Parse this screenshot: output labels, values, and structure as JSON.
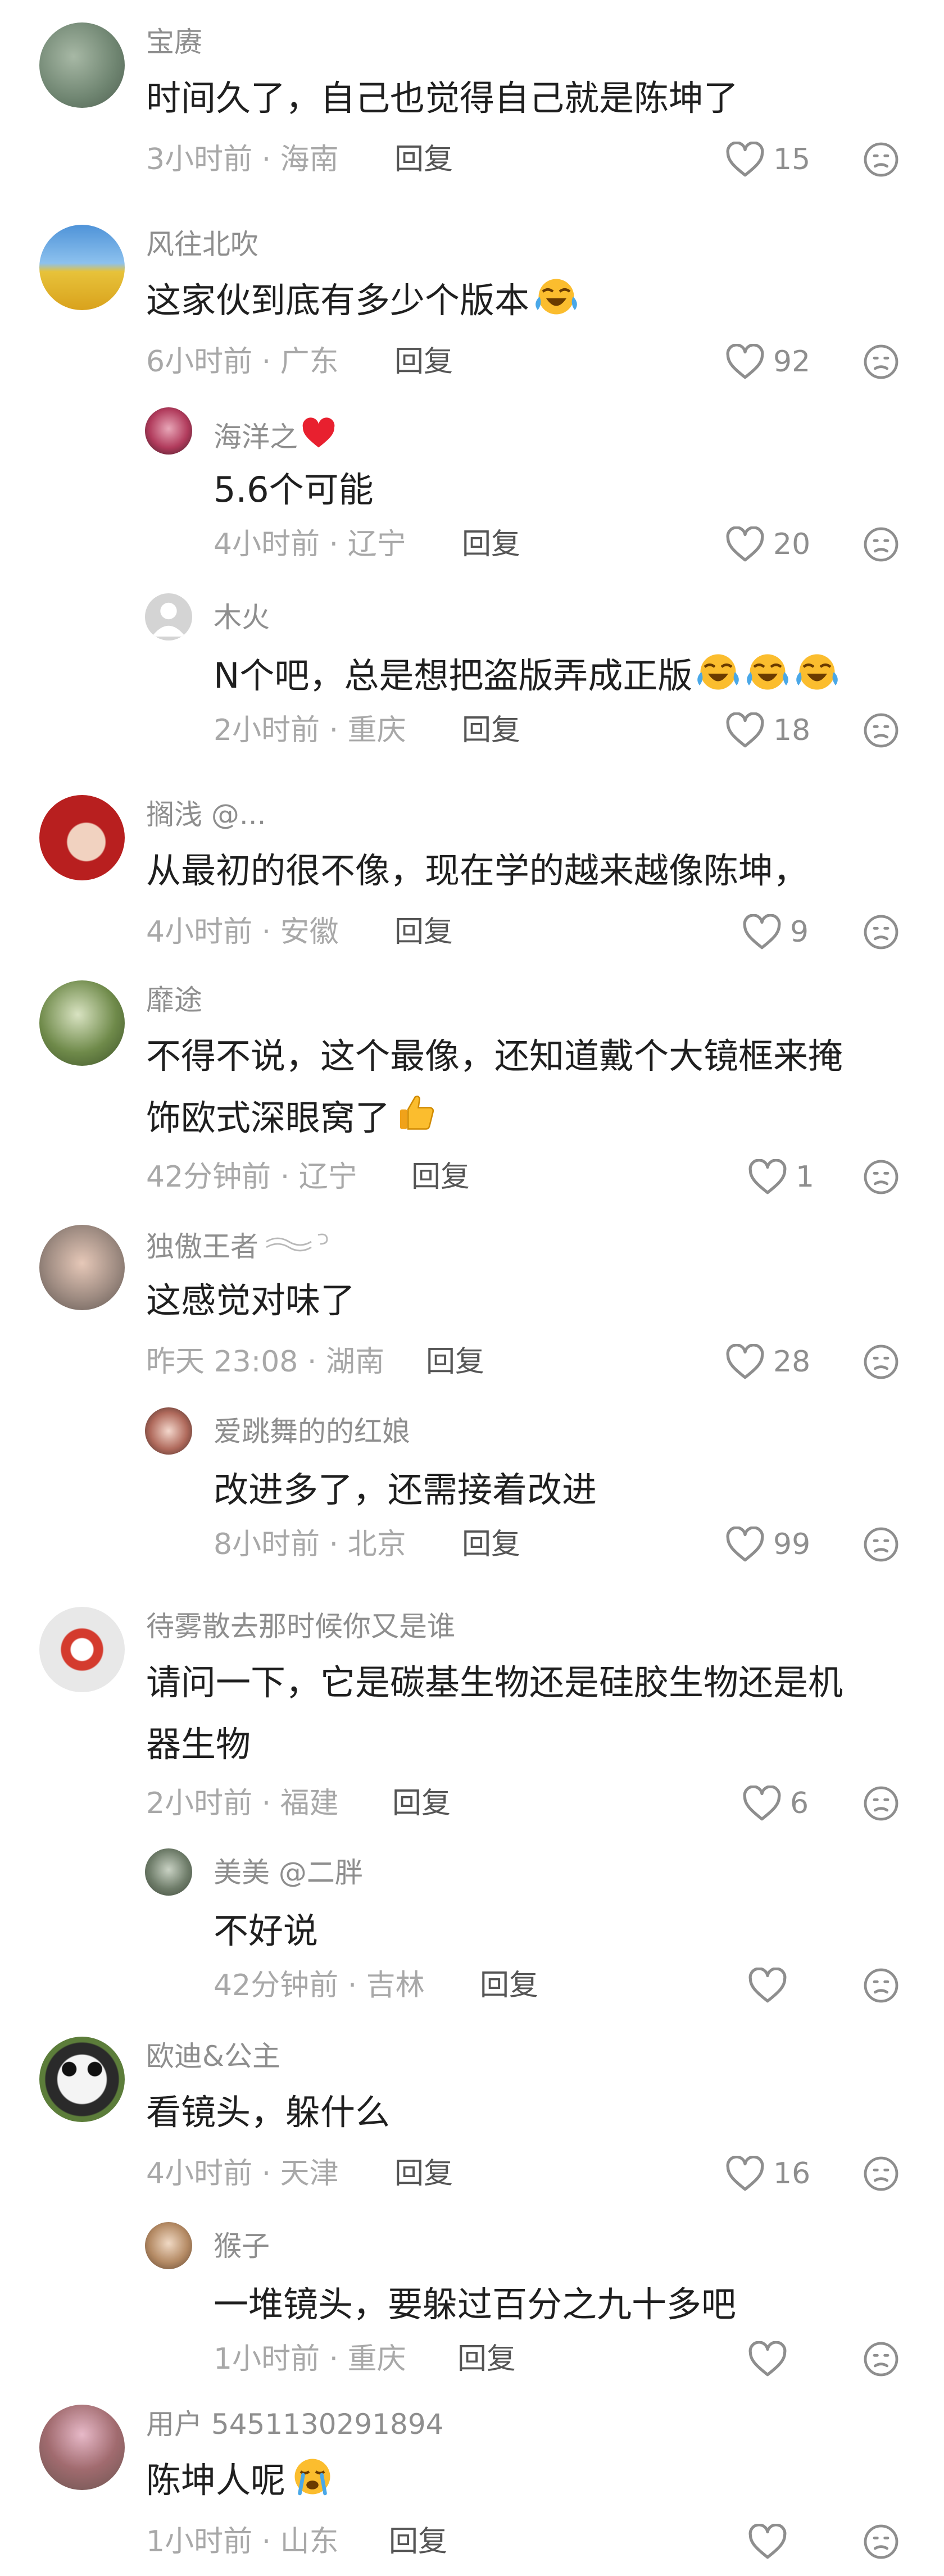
{
  "colors": {
    "text": "#1f1f1f",
    "username": "#8e8e8e",
    "meta": "#a8a8a8",
    "reply": "#555555",
    "icon": "#8e8e8e"
  },
  "icons": {
    "like": "heart-outline-icon",
    "dislike": "dislike-face-icon",
    "laugh": "laughing-crying-emoji",
    "thumb": "thumbs-up-emoji",
    "cry": "crying-emoji",
    "heart": "red-heart-emoji"
  },
  "comments": [
    {
      "user": "宝赓",
      "text": "时间久了，自己也觉得自己就是陈坤了",
      "meta": "3小时前 · 海南",
      "reply": "回复",
      "likes": "15"
    },
    {
      "user": "风往北吹",
      "text": "这家伙到底有多少个版本",
      "meta": "6小时前 · 广东",
      "reply": "回复",
      "likes": "92"
    },
    {
      "user": "海洋之",
      "text": "5.6个可能",
      "meta": "4小时前 · 辽宁",
      "reply": "回复",
      "likes": "20"
    },
    {
      "user": "木火",
      "text": "N个吧，总是想把盗版弄成正版",
      "meta": "2小时前 · 重庆",
      "reply": "回复",
      "likes": "18"
    },
    {
      "user": "搁浅 @...",
      "text": "从最初的很不像，现在学的越来越像陈坤，",
      "meta": "4小时前 · 安徽",
      "reply": "回复",
      "likes": "9"
    },
    {
      "user": "靡途",
      "text_l1": "不得不说，这个最像，还知道戴个大镜框来掩",
      "text_l2": "饰欧式深眼窝了",
      "meta": "42分钟前 · 辽宁",
      "reply": "回复",
      "likes": "1"
    },
    {
      "user": "独傲王者",
      "text": "这感觉对味了",
      "meta": "昨天 23:08 · 湖南",
      "reply": "回复",
      "likes": "28"
    },
    {
      "user": "爱跳舞的的红娘",
      "text": "改进多了，还需接着改进",
      "meta": "8小时前 · 北京",
      "reply": "回复",
      "likes": "99"
    },
    {
      "user": "待雾散去那时候你又是谁",
      "text_l1": "请问一下，它是碳基生物还是硅胶生物还是机",
      "text_l2": "器生物",
      "meta": "2小时前 · 福建",
      "reply": "回复",
      "likes": "6"
    },
    {
      "user": "美美 @二胖",
      "text": "不好说",
      "meta": "42分钟前 · 吉林",
      "reply": "回复",
      "likes": ""
    },
    {
      "user": "欧迪&公主",
      "text": "看镜头，躲什么",
      "meta": "4小时前 · 天津",
      "reply": "回复",
      "likes": "16"
    },
    {
      "user": "猴子",
      "text": "一堆镜头，要躲过百分之九十多吧",
      "meta": "1小时前 · 重庆",
      "reply": "回复",
      "likes": ""
    },
    {
      "user": "用户 5451130291894",
      "text": "陈坤人呢",
      "meta": "1小时前 · 山东",
      "reply": "回复",
      "likes": ""
    }
  ]
}
